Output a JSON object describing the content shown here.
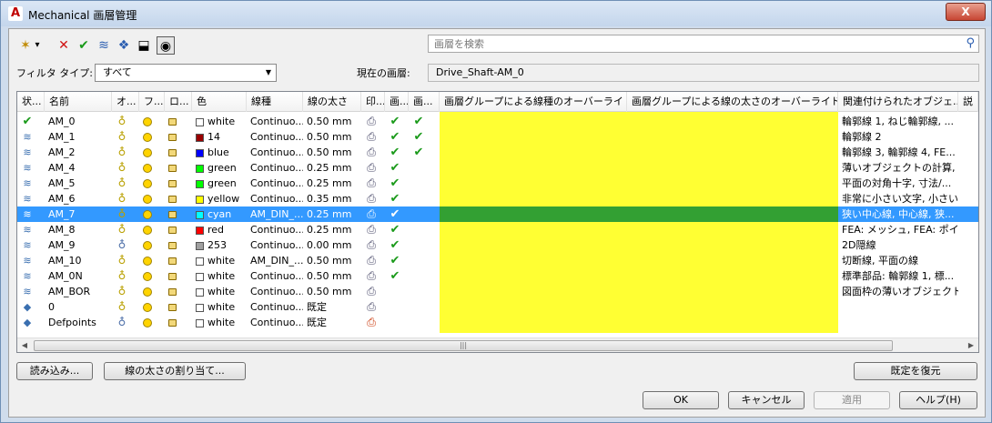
{
  "window": {
    "title": "Mechanical 画層管理",
    "close_label": "X"
  },
  "toolbar": {
    "items": [
      {
        "name": "new-layer-icon",
        "glyph": "✶"
      },
      {
        "name": "dropdown-arrow-icon",
        "glyph": "▾"
      },
      {
        "name": "delete-layer-icon",
        "glyph": "✕"
      },
      {
        "name": "set-current-icon",
        "glyph": "✔"
      },
      {
        "name": "layer-states-icon",
        "glyph": "≋"
      },
      {
        "name": "layer-filter-icon",
        "glyph": "❖"
      },
      {
        "name": "lock-layer-icon",
        "glyph": "⬓"
      },
      {
        "name": "view-toggle-icon",
        "glyph": "◉"
      }
    ]
  },
  "search": {
    "placeholder": "画層を検索"
  },
  "filter": {
    "label": "フィルタ タイプ:",
    "value": "すべて"
  },
  "current_layer": {
    "label": "現在の画層:",
    "value": "Drive_Shaft-AM_0"
  },
  "grid": {
    "headers": [
      "状...",
      "名前",
      "オ...",
      "フ...",
      "ロ...",
      "色",
      "線種",
      "線の太さ",
      "印...",
      "画...",
      "画...",
      "画層グループによる線種のオーバーライド",
      "画層グループによる線の太さのオーバーライド",
      "関連付けられたオブジェ...",
      "説"
    ],
    "rows": [
      {
        "status": "current",
        "name": "AM_0",
        "on": true,
        "color_name": "white",
        "color_hex": "#ffffff",
        "linetype": "Continuo...",
        "lineweight": "0.50 mm",
        "print": true,
        "c1": true,
        "c2": true,
        "assoc": "輪郭線 1, ねじ輪郭線, ..."
      },
      {
        "status": "layer",
        "name": "AM_1",
        "on": true,
        "color_name": "14",
        "color_hex": "#990000",
        "linetype": "Continuo...",
        "lineweight": "0.50 mm",
        "print": true,
        "c1": true,
        "c2": true,
        "assoc": "輪郭線 2"
      },
      {
        "status": "layer",
        "name": "AM_2",
        "on": true,
        "color_name": "blue",
        "color_hex": "#0000ff",
        "linetype": "Continuo...",
        "lineweight": "0.50 mm",
        "print": true,
        "c1": true,
        "c2": true,
        "assoc": "輪郭線 3, 輪郭線 4, FE..."
      },
      {
        "status": "layer",
        "name": "AM_4",
        "on": true,
        "color_name": "green",
        "color_hex": "#00ff00",
        "linetype": "Continuo...",
        "lineweight": "0.25 mm",
        "print": true,
        "c1": true,
        "c2": false,
        "assoc": "薄いオブジェクトの計算, オ..."
      },
      {
        "status": "layer",
        "name": "AM_5",
        "on": true,
        "color_name": "green",
        "color_hex": "#00ff00",
        "linetype": "Continuo...",
        "lineweight": "0.25 mm",
        "print": true,
        "c1": true,
        "c2": false,
        "assoc": "平面の対角十字, 寸法/..."
      },
      {
        "status": "layer",
        "name": "AM_6",
        "on": true,
        "color_name": "yellow",
        "color_hex": "#ffff00",
        "linetype": "Continuo...",
        "lineweight": "0.35 mm",
        "print": true,
        "c1": true,
        "c2": false,
        "assoc": "非常に小さい文字, 小さい..."
      },
      {
        "status": "layer",
        "name": "AM_7",
        "on": true,
        "color_name": "cyan",
        "color_hex": "#00ffff",
        "linetype": "AM_DIN_...",
        "lineweight": "0.25 mm",
        "print": true,
        "c1": true,
        "c2": false,
        "assoc": "狭い中心線, 中心線, 狭...",
        "selected": true
      },
      {
        "status": "layer",
        "name": "AM_8",
        "on": true,
        "color_name": "red",
        "color_hex": "#ff0000",
        "linetype": "Continuo...",
        "lineweight": "0.25 mm",
        "print": true,
        "c1": true,
        "c2": false,
        "assoc": "FEA: メッシュ, FEA: ポイン..."
      },
      {
        "status": "layer",
        "name": "AM_9",
        "on": false,
        "color_name": "253",
        "color_hex": "#a0a0a0",
        "linetype": "Continuo...",
        "lineweight": "0.00 mm",
        "print": true,
        "c1": true,
        "c2": false,
        "assoc": "2D隠線"
      },
      {
        "status": "layer",
        "name": "AM_10",
        "on": true,
        "color_name": "white",
        "color_hex": "#ffffff",
        "linetype": "AM_DIN_...",
        "lineweight": "0.50 mm",
        "print": true,
        "c1": true,
        "c2": false,
        "assoc": "切断線, 平面の線"
      },
      {
        "status": "layer",
        "name": "AM_0N",
        "on": true,
        "color_name": "white",
        "color_hex": "#ffffff",
        "linetype": "Continuo...",
        "lineweight": "0.50 mm",
        "print": true,
        "c1": true,
        "c2": false,
        "assoc": "標準部品: 輪郭線 1, 標..."
      },
      {
        "status": "layer",
        "name": "AM_BOR",
        "on": true,
        "color_name": "white",
        "color_hex": "#ffffff",
        "linetype": "Continuo...",
        "lineweight": "0.50 mm",
        "print": true,
        "c1": false,
        "c2": false,
        "assoc": "図面枠の薄いオブジェクト..."
      },
      {
        "status": "plain",
        "name": "0",
        "on": true,
        "color_name": "white",
        "color_hex": "#ffffff",
        "linetype": "Continuo...",
        "lineweight": "既定",
        "print": true,
        "c1": false,
        "c2": false,
        "assoc": ""
      },
      {
        "status": "plain",
        "name": "Defpoints",
        "on": false,
        "color_name": "white",
        "color_hex": "#ffffff",
        "linetype": "Continuo...",
        "lineweight": "既定",
        "print": false,
        "c1": false,
        "c2": false,
        "assoc": ""
      }
    ]
  },
  "buttons": {
    "load": "読み込み...",
    "assign_lineweight": "線の太さの割り当て...",
    "restore_default": "既定を復元",
    "ok": "OK",
    "cancel": "キャンセル",
    "apply": "適用",
    "help": "ヘルプ(H)"
  },
  "colors": {
    "highlight": "#ffff33",
    "selection": "#3399ff"
  }
}
